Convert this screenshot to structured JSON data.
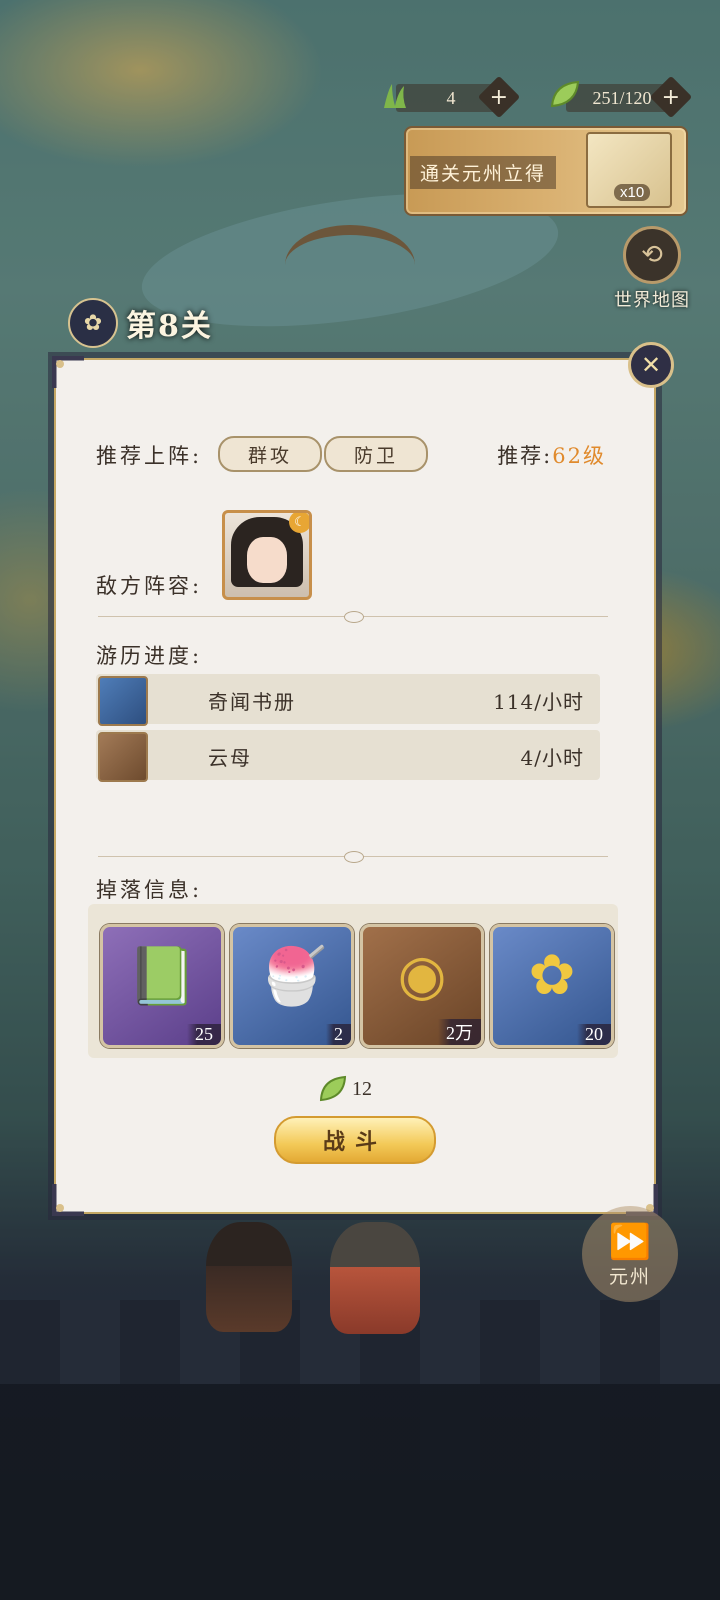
{
  "resources": [
    {
      "value": "4",
      "icon": "grass-icon",
      "plus": "+"
    },
    {
      "value": "251/120",
      "icon": "leaf-icon",
      "plus": "+"
    }
  ],
  "reward_banner": {
    "label": "通关元州立得",
    "count": "x10"
  },
  "world_map": {
    "label": "世界地图"
  },
  "stage": {
    "title": "第8关"
  },
  "panel": {
    "recommend_label": "推荐上阵:",
    "tags": [
      "群攻",
      "防卫"
    ],
    "recommend_level_label": "推荐:",
    "recommend_level_value": "62级",
    "enemy_label": "敌方阵容:",
    "progress_label": "游历进度:",
    "progress": [
      {
        "name": "奇闻书册",
        "rate": "114/小时",
        "icon": "book-icon"
      },
      {
        "name": "云母",
        "rate": "4/小时",
        "icon": "mica-icon"
      }
    ],
    "drops_label": "掉落信息:",
    "drops": [
      {
        "qty": "25",
        "icon": "book-icon",
        "color": "#6f4fa0"
      },
      {
        "qty": "2",
        "icon": "bowl-icon",
        "color": "#4a6aa8"
      },
      {
        "qty": "2万",
        "icon": "coin-icon",
        "color": "#85593a"
      },
      {
        "qty": "20",
        "icon": "osmanthus-icon",
        "color": "#4a6aa8"
      }
    ],
    "cost_value": "12",
    "fight_label": "战斗"
  },
  "next_area": {
    "label": "元州"
  }
}
